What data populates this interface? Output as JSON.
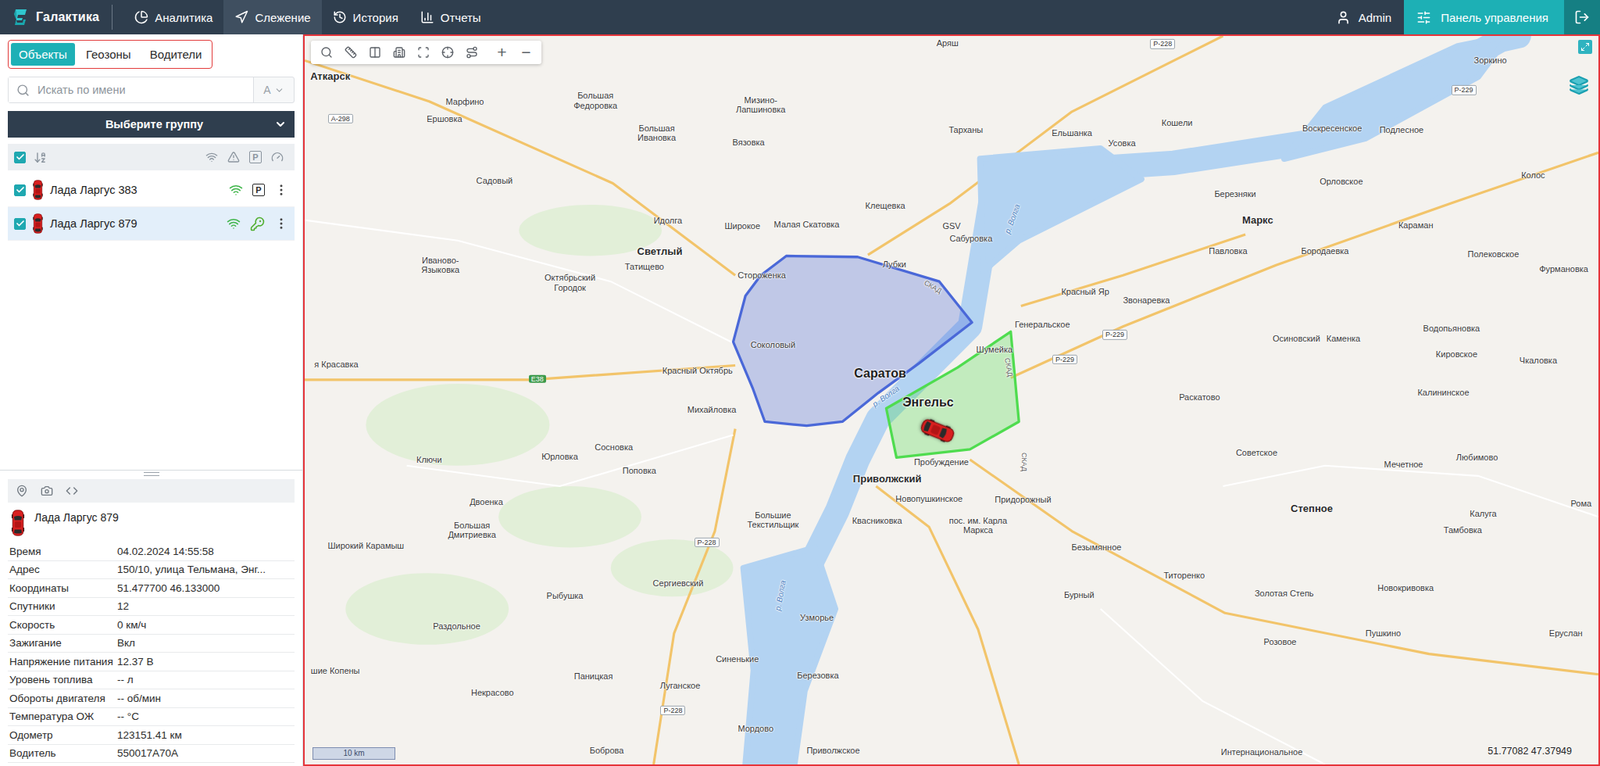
{
  "app": {
    "logo": "Галактика"
  },
  "nav": [
    {
      "label": "Аналитика",
      "kind": "analytics",
      "selected": false
    },
    {
      "label": "Слежение",
      "kind": "tracking",
      "selected": true
    },
    {
      "label": "История",
      "kind": "history",
      "selected": false
    },
    {
      "label": "Отчеты",
      "kind": "reports",
      "selected": false
    }
  ],
  "user": {
    "name": "Admin"
  },
  "control_panel": {
    "label": "Панель управления"
  },
  "sidebar_tabs": [
    {
      "label": "Объекты",
      "selected": true
    },
    {
      "label": "Геозоны",
      "selected": false
    },
    {
      "label": "Водители",
      "selected": false
    }
  ],
  "search": {
    "placeholder": "Искать по имени",
    "sort": "А"
  },
  "group_select": {
    "label": "Выберите группу"
  },
  "list_header": {
    "checked": true,
    "columns": [
      {
        "kind": "signal"
      },
      {
        "kind": "alert"
      },
      {
        "kind": "parking",
        "text": "P"
      },
      {
        "kind": "speed"
      }
    ]
  },
  "objects": [
    {
      "name": "Лада Ларгус 383",
      "checked": true,
      "selected": false,
      "online": true,
      "status": {
        "kind": "parking",
        "text": "P"
      }
    },
    {
      "name": "Лада Ларгус 879",
      "checked": true,
      "selected": true,
      "online": true,
      "status": {
        "kind": "ignition"
      }
    }
  ],
  "details": {
    "tabs": [
      {
        "kind": "location"
      },
      {
        "kind": "photo"
      },
      {
        "kind": "code"
      }
    ],
    "name": "Лада Ларгус 879",
    "rows": [
      {
        "label": "Время",
        "value": "04.02.2024 14:55:58"
      },
      {
        "label": "Адрес",
        "value": "150/10, улица Тельмана, Энг..."
      },
      {
        "label": "Координаты",
        "value": "51.477700 46.133000"
      },
      {
        "label": "Спутники",
        "value": "12"
      },
      {
        "label": "Скорость",
        "value": "0 км/ч"
      },
      {
        "label": "Зажигание",
        "value": "Вкл"
      },
      {
        "label": "Напряжение питания",
        "value": "12.37 В"
      },
      {
        "label": "Уровень топлива",
        "value": "-- л"
      },
      {
        "label": "Обороты двигателя",
        "value": "-- об/мин"
      },
      {
        "label": "Температура ОЖ",
        "value": "-- °С"
      },
      {
        "label": "Одометр",
        "value": "123151.41 км"
      },
      {
        "label": "Водитель",
        "value": "550017A70A"
      }
    ]
  },
  "map": {
    "zoom_in": "+",
    "zoom_out": "−",
    "scale": "10 km",
    "coordinates": "51.77082 47.37949",
    "geozones": [
      {
        "color": "#4a68d8"
      },
      {
        "color": "#4fdc4f"
      }
    ],
    "labels": [
      {
        "text": "Аткарск",
        "kind": "town"
      },
      {
        "text": "Аряш",
        "kind": "village"
      },
      {
        "text": "Р-228",
        "kind": "road"
      },
      {
        "text": "Зоркино",
        "kind": "village"
      },
      {
        "text": "Р-229",
        "kind": "road"
      },
      {
        "text": "Марфино",
        "kind": "village"
      },
      {
        "text": "Большая Федоровка",
        "kind": "stacked"
      },
      {
        "text": "Мизино-Лапшиновка",
        "kind": "stacked"
      },
      {
        "text": "А-298",
        "kind": "road"
      },
      {
        "text": "Ершовка",
        "kind": "village"
      },
      {
        "text": "Большая Ивановка",
        "kind": "stacked"
      },
      {
        "text": "Вязовка",
        "kind": "village"
      },
      {
        "text": "Тарханы",
        "kind": "village"
      },
      {
        "text": "Ельшанка",
        "kind": "village"
      },
      {
        "text": "Усовка",
        "kind": "village"
      },
      {
        "text": "Кошели",
        "kind": "village"
      },
      {
        "text": "Воскресенское",
        "kind": "village"
      },
      {
        "text": "Подлесное",
        "kind": "village"
      },
      {
        "text": "Садовый",
        "kind": "village"
      },
      {
        "text": "Орловское",
        "kind": "village"
      },
      {
        "text": "Колос",
        "kind": "village"
      },
      {
        "text": "Березняки",
        "kind": "village"
      },
      {
        "text": "Клещевка",
        "kind": "village"
      },
      {
        "text": "Идолга",
        "kind": "village"
      },
      {
        "text": "Широкое",
        "kind": "village"
      },
      {
        "text": "Малая Скатовка",
        "kind": "village"
      },
      {
        "text": "GSV",
        "kind": "village"
      },
      {
        "text": "Сабуровка",
        "kind": "village"
      },
      {
        "text": "Маркс",
        "kind": "town"
      },
      {
        "text": "Караман",
        "kind": "village"
      },
      {
        "text": "Светлый",
        "kind": "town"
      },
      {
        "text": "Татищево",
        "kind": "village"
      },
      {
        "text": "Лубки",
        "kind": "village"
      },
      {
        "text": "Павловка",
        "kind": "village"
      },
      {
        "text": "Бородаевка",
        "kind": "village"
      },
      {
        "text": "Полековское",
        "kind": "village"
      },
      {
        "text": "Фурмановка",
        "kind": "village"
      },
      {
        "text": "Иваново-Языковка",
        "kind": "stacked"
      },
      {
        "text": "Октябрьский Городок",
        "kind": "stacked"
      },
      {
        "text": "Стороженка",
        "kind": "village"
      },
      {
        "text": "Красный Яр",
        "kind": "village"
      },
      {
        "text": "Звонаревка",
        "kind": "village"
      },
      {
        "text": "Генеральское",
        "kind": "village"
      },
      {
        "text": "Р-229",
        "kind": "road"
      },
      {
        "text": "Осиновский",
        "kind": "village"
      },
      {
        "text": "Каменка",
        "kind": "village"
      },
      {
        "text": "Водопьяновка",
        "kind": "village"
      },
      {
        "text": "Кировское",
        "kind": "village"
      },
      {
        "text": "Чкаловка",
        "kind": "village"
      },
      {
        "text": "Соколовый",
        "kind": "village"
      },
      {
        "text": "Шумейка",
        "kind": "village"
      },
      {
        "text": "Р-229",
        "kind": "road"
      },
      {
        "text": "я Красавка",
        "kind": "village"
      },
      {
        "text": "Красный Октябрь",
        "kind": "village"
      },
      {
        "text": "Саратов",
        "kind": "city"
      },
      {
        "text": "E38",
        "kind": "eroad"
      },
      {
        "text": "Раскатово",
        "kind": "village"
      },
      {
        "text": "Калининское",
        "kind": "village"
      },
      {
        "text": "Энгельс",
        "kind": "city"
      },
      {
        "text": "Михайловка",
        "kind": "village"
      },
      {
        "text": "Ключи",
        "kind": "village"
      },
      {
        "text": "Юрловка",
        "kind": "village"
      },
      {
        "text": "Сосновка",
        "kind": "village"
      },
      {
        "text": "Поповка",
        "kind": "village"
      },
      {
        "text": "Пробуждение",
        "kind": "village"
      },
      {
        "text": "Советское",
        "kind": "village"
      },
      {
        "text": "Мечетное",
        "kind": "village"
      },
      {
        "text": "Любимово",
        "kind": "village"
      },
      {
        "text": "Приволжский",
        "kind": "town"
      },
      {
        "text": "Новопушкинское",
        "kind": "village"
      },
      {
        "text": "Придорожный",
        "kind": "village"
      },
      {
        "text": "Двоенка",
        "kind": "village"
      },
      {
        "text": "Рома",
        "kind": "village"
      },
      {
        "text": "Степное",
        "kind": "town"
      },
      {
        "text": "Калуга",
        "kind": "village"
      },
      {
        "text": "Большие Текстильщик",
        "kind": "stacked"
      },
      {
        "text": "Квасниковка",
        "kind": "village"
      },
      {
        "text": "пос. им. Карла Маркса",
        "kind": "stacked"
      },
      {
        "text": "Большая Дмитриевка",
        "kind": "stacked"
      },
      {
        "text": "Тамбовка",
        "kind": "village"
      },
      {
        "text": "Р-228",
        "kind": "road"
      },
      {
        "text": "Широкий Карамыш",
        "kind": "village"
      },
      {
        "text": "Безымянное",
        "kind": "village"
      },
      {
        "text": "Титоренко",
        "kind": "village"
      },
      {
        "text": "Сергиевский",
        "kind": "village"
      },
      {
        "text": "Новокривовка",
        "kind": "village"
      },
      {
        "text": "Бурный",
        "kind": "village"
      },
      {
        "text": "Золотая Степь",
        "kind": "village"
      },
      {
        "text": "Рыбушка",
        "kind": "village"
      },
      {
        "text": "Узморье",
        "kind": "village"
      },
      {
        "text": "Раздольное",
        "kind": "village"
      },
      {
        "text": "Пушкино",
        "kind": "village"
      },
      {
        "text": "Еруслан",
        "kind": "village"
      },
      {
        "text": "Розовое",
        "kind": "village"
      },
      {
        "text": "Синенькие",
        "kind": "village"
      },
      {
        "text": "шие Копены",
        "kind": "village"
      },
      {
        "text": "Березовка",
        "kind": "village"
      },
      {
        "text": "Паницкая",
        "kind": "village"
      },
      {
        "text": "Луганское",
        "kind": "village"
      },
      {
        "text": "Некрасово",
        "kind": "village"
      },
      {
        "text": "Р-228",
        "kind": "road"
      },
      {
        "text": "Мордово",
        "kind": "village"
      },
      {
        "text": "Боброва",
        "kind": "village"
      },
      {
        "text": "Приволжское",
        "kind": "village"
      },
      {
        "text": "Интернациональное",
        "kind": "village"
      },
      {
        "text": "р. Волга",
        "kind": "river"
      },
      {
        "text": "р. Волга",
        "kind": "river"
      },
      {
        "text": "р. Волга",
        "kind": "river"
      },
      {
        "text": "СКАД",
        "kind": "ring"
      },
      {
        "text": "СКАД",
        "kind": "ring"
      },
      {
        "text": "СКАД",
        "kind": "ring"
      }
    ]
  }
}
